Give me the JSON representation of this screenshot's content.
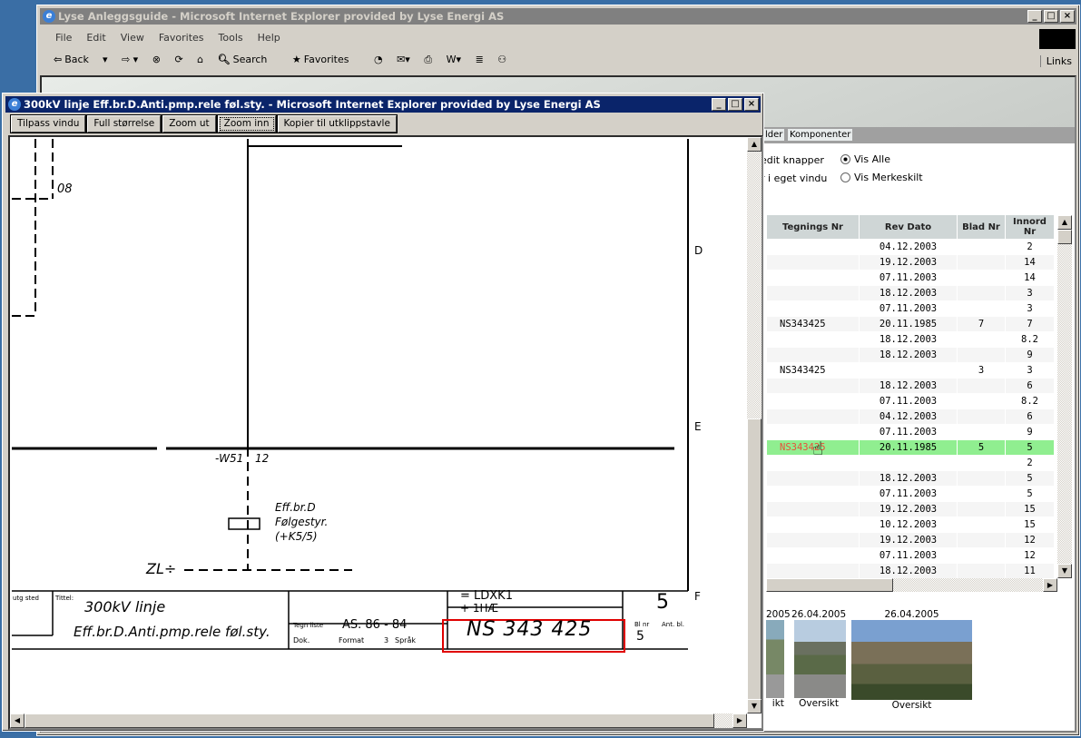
{
  "main_window": {
    "title": "Lyse Anleggsguide - Microsoft Internet Explorer provided by Lyse Energi AS",
    "menu": [
      "File",
      "Edit",
      "View",
      "Favorites",
      "Tools",
      "Help"
    ],
    "toolbar": {
      "back": "Back",
      "search": "Search",
      "favorites": "Favorites",
      "links": "Links"
    },
    "tabs": [
      "lder",
      "Komponenter"
    ],
    "options": {
      "left1": "edit knapper",
      "left2": "r i eget vindu",
      "radio1": "Vis Alle",
      "radio2": "Vis Merkeskilt",
      "selected": "Vis Alle"
    },
    "table": {
      "headers": [
        "Tegnings Nr",
        "Rev Dato",
        "Blad Nr",
        "Innord Nr"
      ],
      "rows": [
        [
          "",
          "04.12.2003",
          "",
          "2"
        ],
        [
          "",
          "19.12.2003",
          "",
          "14"
        ],
        [
          "",
          "07.11.2003",
          "",
          "14"
        ],
        [
          "",
          "18.12.2003",
          "",
          "3"
        ],
        [
          "",
          "07.11.2003",
          "",
          "3"
        ],
        [
          "NS343425",
          "20.11.1985",
          "7",
          "7"
        ],
        [
          "",
          "18.12.2003",
          "",
          "8.2"
        ],
        [
          "",
          "18.12.2003",
          "",
          "9"
        ],
        [
          "NS343425",
          "",
          "3",
          "3"
        ],
        [
          "",
          "18.12.2003",
          "",
          "6"
        ],
        [
          "",
          "07.11.2003",
          "",
          "8.2"
        ],
        [
          "",
          "04.12.2003",
          "",
          "6"
        ],
        [
          "",
          "07.11.2003",
          "",
          "9"
        ],
        [
          "NS343425",
          "20.11.1985",
          "5",
          "5"
        ],
        [
          "",
          "",
          "",
          "2"
        ],
        [
          "",
          "18.12.2003",
          "",
          "5"
        ],
        [
          "",
          "07.11.2003",
          "",
          "5"
        ],
        [
          "",
          "19.12.2003",
          "",
          "15"
        ],
        [
          "",
          "10.12.2003",
          "",
          "15"
        ],
        [
          "",
          "19.12.2003",
          "",
          "12"
        ],
        [
          "",
          "07.11.2003",
          "",
          "12"
        ],
        [
          "",
          "18.12.2003",
          "",
          "11"
        ]
      ],
      "highlighted_row": 13,
      "highlight_color": "#90ee90",
      "link_color": "#e8503a"
    },
    "photos": [
      {
        "date": "2005",
        "caption": "ikt"
      },
      {
        "date": "26.04.2005",
        "caption": "Oversikt"
      },
      {
        "date": "26.04.2005",
        "caption": "Oversikt"
      }
    ]
  },
  "popup": {
    "title": "300kV linje Eff.br.D.Anti.pmp.rele føl.sty. - Microsoft Internet Explorer provided by Lyse Energi AS",
    "buttons": [
      "Tilpass vindu",
      "Full størrelse",
      "Zoom ut",
      "Zoom inn",
      "Kopier til utklippstavle"
    ],
    "drawing": {
      "label_08": "08",
      "label_w51": "-W51",
      "label_12": "12",
      "desc1": "Eff.br.D",
      "desc2": "Følgestyr.",
      "desc3": "(+K5/5)",
      "label_zl": "ZL÷",
      "row_d": "D",
      "row_e": "E",
      "row_f": "F",
      "tb_left": "utg sted",
      "tb_tittel": "Tittel:",
      "title1": "300kV linje",
      "title2": "Eff.br.D.Anti.pmp.rele føl.sty.",
      "ldxk": "= LDXK1",
      "ihae": "+ 1HÆ",
      "sheet_big": "5",
      "tegn_liste_label": "Tegn liste",
      "tegn_liste": "AS. 86 - 84",
      "dok": "Dok.",
      "format": "Format",
      "format_val": "3",
      "sprak": "Språk",
      "drawing_no": "NS 343 425",
      "blad_label": "Bl nr",
      "blad": "5",
      "ant_label": "Ant. bl.",
      "highlight_box_color": "#e00000"
    }
  }
}
